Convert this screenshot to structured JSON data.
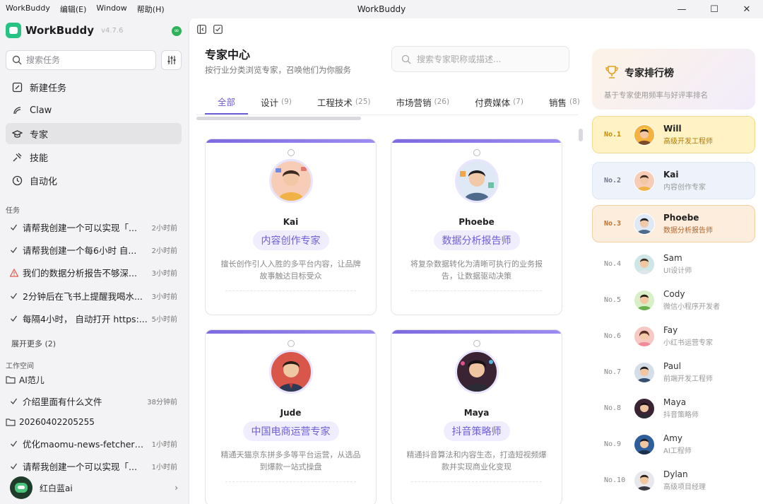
{
  "window": {
    "menu": [
      "WorkBuddy",
      "编辑(E)",
      "Window",
      "帮助(H)"
    ],
    "title": "WorkBuddy",
    "controls": [
      "—",
      "☐",
      "✕"
    ]
  },
  "brand": {
    "name": "WorkBuddy",
    "version": "v4.7.6",
    "accent": "#28c384"
  },
  "sidebar": {
    "search_placeholder": "搜索任务",
    "nav": [
      {
        "label": "新建任务",
        "icon": "edit-icon"
      },
      {
        "label": "Claw",
        "icon": "claw-icon"
      },
      {
        "label": "专家",
        "icon": "graduation-cap-icon",
        "active": true
      },
      {
        "label": "技能",
        "icon": "skill-icon"
      },
      {
        "label": "自动化",
        "icon": "clock-icon"
      }
    ],
    "tasks_label": "任务",
    "tasks": [
      {
        "text": "请帮我创建一个可以实现「...",
        "time": "2小时前",
        "status": "done"
      },
      {
        "text": "请帮我创建一个每6小时 自...",
        "time": "2小时前",
        "status": "done"
      },
      {
        "text": "我们的数据分析报告不够深...",
        "time": "3小时前",
        "status": "warning"
      },
      {
        "text": "2分钟后在飞书上提醒我喝水...",
        "time": "3小时前",
        "status": "done"
      },
      {
        "text": "每隔4小时， 自动打开 https:...",
        "time": "5小时前",
        "status": "done"
      }
    ],
    "more_label": "展开更多 (2)",
    "workspace_label": "工作空间",
    "workspaces": [
      {
        "folder": "AI范儿",
        "tasks": [
          {
            "text": "介绍里面有什么文件",
            "time": "38分钟前"
          }
        ]
      },
      {
        "folder": "20260402205255",
        "tasks": [
          {
            "text": "优化maomu-news-fetcher这...",
            "time": "1小时前"
          },
          {
            "text": "请帮我创建一个可以实现「...",
            "time": "1小时前"
          }
        ]
      }
    ],
    "user": {
      "name": "红白蓝ai"
    }
  },
  "main": {
    "title": "专家中心",
    "subtitle": "按行业分类浏览专家，召唤他们为你服务",
    "search_placeholder": "搜索专家职称或描述...",
    "accent": "#6e5fd6",
    "tabs": [
      {
        "label": "全部",
        "count": "",
        "active": true
      },
      {
        "label": "设计",
        "count": "(9)"
      },
      {
        "label": "工程技术",
        "count": "(25)"
      },
      {
        "label": "市场营销",
        "count": "(26)"
      },
      {
        "label": "付费媒体",
        "count": "(7)"
      },
      {
        "label": "销售",
        "count": "(8)"
      }
    ],
    "cards": [
      {
        "name": "Kai",
        "role": "内容创作专家",
        "desc": "擅长创作引人入胜的多平台内容，让品牌故事触达目标受众"
      },
      {
        "name": "Phoebe",
        "role": "数据分析报告师",
        "desc": "将复杂数据转化为清晰可执行的业务报告，让数据驱动决策"
      },
      {
        "name": "Jude",
        "role": "中国电商运营专家",
        "desc": "精通天猫京东拼多多等平台运营，从选品到爆款一站式操盘"
      },
      {
        "name": "Maya",
        "role": "抖音策略师",
        "desc": "精通抖音算法和内容生态，打造短视频爆款并实现商业化变现"
      }
    ]
  },
  "ranking": {
    "title": "专家排行榜",
    "subtitle": "基于专家使用频率与好评率排名",
    "items": [
      {
        "no": "No.1",
        "name": "Will",
        "role": "高级开发工程师"
      },
      {
        "no": "No.2",
        "name": "Kai",
        "role": "内容创作专家"
      },
      {
        "no": "No.3",
        "name": "Phoebe",
        "role": "数据分析报告师"
      },
      {
        "no": "No.4",
        "name": "Sam",
        "role": "UI设计师"
      },
      {
        "no": "No.5",
        "name": "Cody",
        "role": "微信小程序开发者"
      },
      {
        "no": "No.6",
        "name": "Fay",
        "role": "小红书运营专家"
      },
      {
        "no": "No.7",
        "name": "Paul",
        "role": "前端开发工程师"
      },
      {
        "no": "No.8",
        "name": "Maya",
        "role": "抖音策略师"
      },
      {
        "no": "No.9",
        "name": "Amy",
        "role": "AI工程师"
      },
      {
        "no": "No.10",
        "name": "Dylan",
        "role": "高级项目经理"
      }
    ]
  }
}
